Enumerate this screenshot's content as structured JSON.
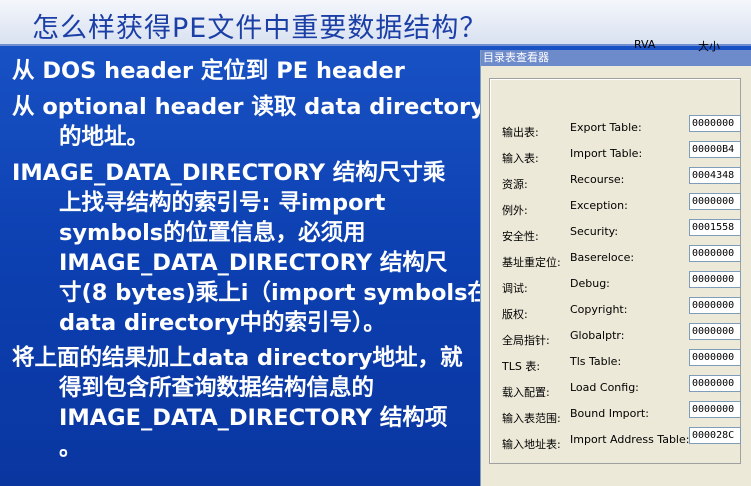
{
  "slide": {
    "title": "怎么样获得PE文件中重要数据结构？",
    "paragraphs": [
      {
        "lines": [
          "从 DOS header 定位到 PE header"
        ]
      },
      {
        "lines": [
          "从 optional header 读取 data directory",
          "的地址。"
        ]
      },
      {
        "lines": [
          "IMAGE_DATA_DIRECTORY 结构尺寸乘",
          "上找寻结构的索引号: 寻import",
          "symbols的位置信息，必须用",
          "IMAGE_DATA_DIRECTORY 结构尺",
          "寸(8 bytes)乘上i（import symbols在",
          "data directory中的索引号）。"
        ]
      },
      {
        "lines": [
          "将上面的结果加上data directory地址，就",
          "得到包含所查询数据结构信息的",
          "IMAGE_DATA_DIRECTORY 结构项",
          "。"
        ]
      }
    ]
  },
  "viewer": {
    "title": "目录表查看器",
    "col_rva": "RVA",
    "col_size": "大小",
    "rows": [
      {
        "cn": "输出表:",
        "en": "Export Table:",
        "value": "0000000"
      },
      {
        "cn": "输入表:",
        "en": "Import Table:",
        "value": "00000B4"
      },
      {
        "cn": "资源:",
        "en": "Recourse:",
        "value": "0004348"
      },
      {
        "cn": "例外:",
        "en": "Exception:",
        "value": "0000000"
      },
      {
        "cn": "安全性:",
        "en": "Security:",
        "value": "0001558"
      },
      {
        "cn": "基址重定位:",
        "en": "Basereloce:",
        "value": "0000000"
      },
      {
        "cn": "调试:",
        "en": "Debug:",
        "value": "0000000"
      },
      {
        "cn": "版权:",
        "en": "Copyright:",
        "value": "0000000"
      },
      {
        "cn": "全局指针:",
        "en": "Globalptr:",
        "value": "0000000"
      },
      {
        "cn": "TLS 表:",
        "en": "Tls Table:",
        "value": "0000000"
      },
      {
        "cn": "载入配置:",
        "en": "Load Config:",
        "value": "0000000"
      },
      {
        "cn": "输入表范围:",
        "en": "Bound Import:",
        "value": "0000000"
      },
      {
        "cn": "输入地址表:",
        "en": "Import Address Table:",
        "value": "000028C"
      }
    ]
  }
}
